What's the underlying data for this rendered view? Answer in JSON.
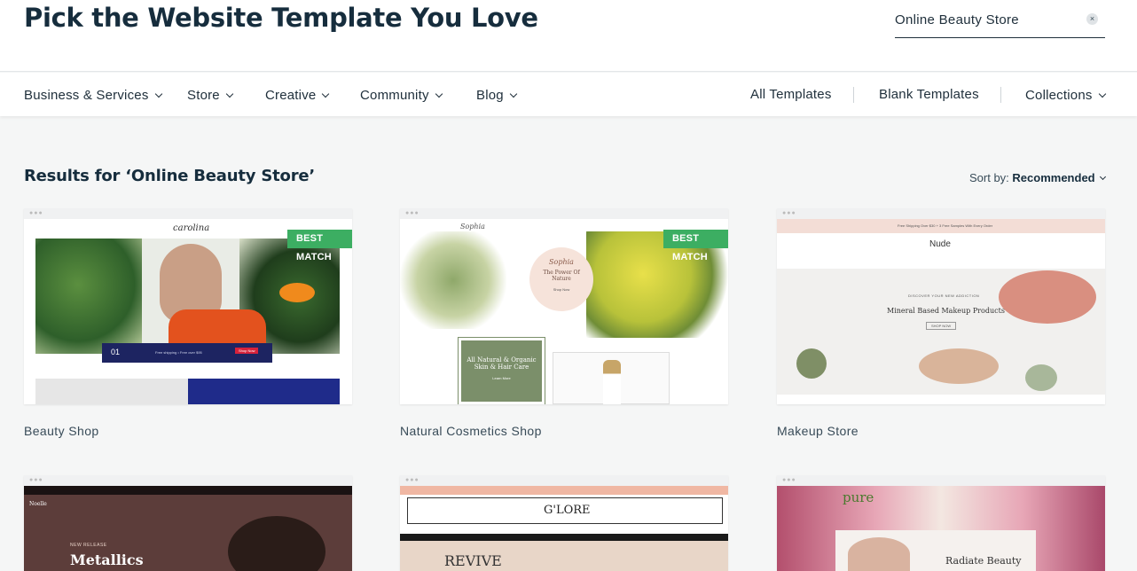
{
  "header": {
    "title": "Pick the Website Template You Love",
    "search_value": "Online Beauty Store",
    "clear_icon": "×"
  },
  "nav": {
    "left": [
      "Business & Services",
      "Store",
      "Creative",
      "Community",
      "Blog"
    ],
    "right": [
      "All Templates",
      "Blank Templates",
      "Collections"
    ]
  },
  "results": {
    "heading": "Results for ‘Online Beauty Store’",
    "sort_label": "Sort by:",
    "sort_value": "Recommended"
  },
  "cards": [
    {
      "name": "Beauty Shop",
      "badge": "BEST MATCH"
    },
    {
      "name": "Natural Cosmetics Shop",
      "badge": "BEST MATCH"
    },
    {
      "name": "Makeup Store",
      "badge": ""
    }
  ],
  "thumb_text": {
    "beauty_logo": "carolina",
    "beauty_num": "01",
    "beauty_ship": "Free shipping • Free over $95",
    "beauty_btn": "Shop Now",
    "nat_logo": "Sophia",
    "nat_hero": "The Power Of Nature",
    "nat_cta": "Shop Now",
    "nat_box": "All Natural & Organic Skin & Hair Care",
    "nat_box_btn": "Learn More",
    "nude_banner": "Free Shipping Over $30 + 3 Free Samples With Every Order",
    "nude_logo": "Nude",
    "nude_tag": "DISCOVER YOUR NEW ADDICTION",
    "nude_head": "Mineral Based Makeup Products",
    "nude_btn": "SHOP NOW",
    "noelle_logo": "Noelle",
    "noelle_new": "NEW RELEASE",
    "noelle_head": "Metallics",
    "glore_logo": "G'LORE",
    "glore_head": "REVIVE",
    "pure_logo": "pure",
    "pure_head": "Radiate Beauty"
  },
  "colors": {
    "badge": "#3cae62",
    "accent": "#20303c"
  }
}
